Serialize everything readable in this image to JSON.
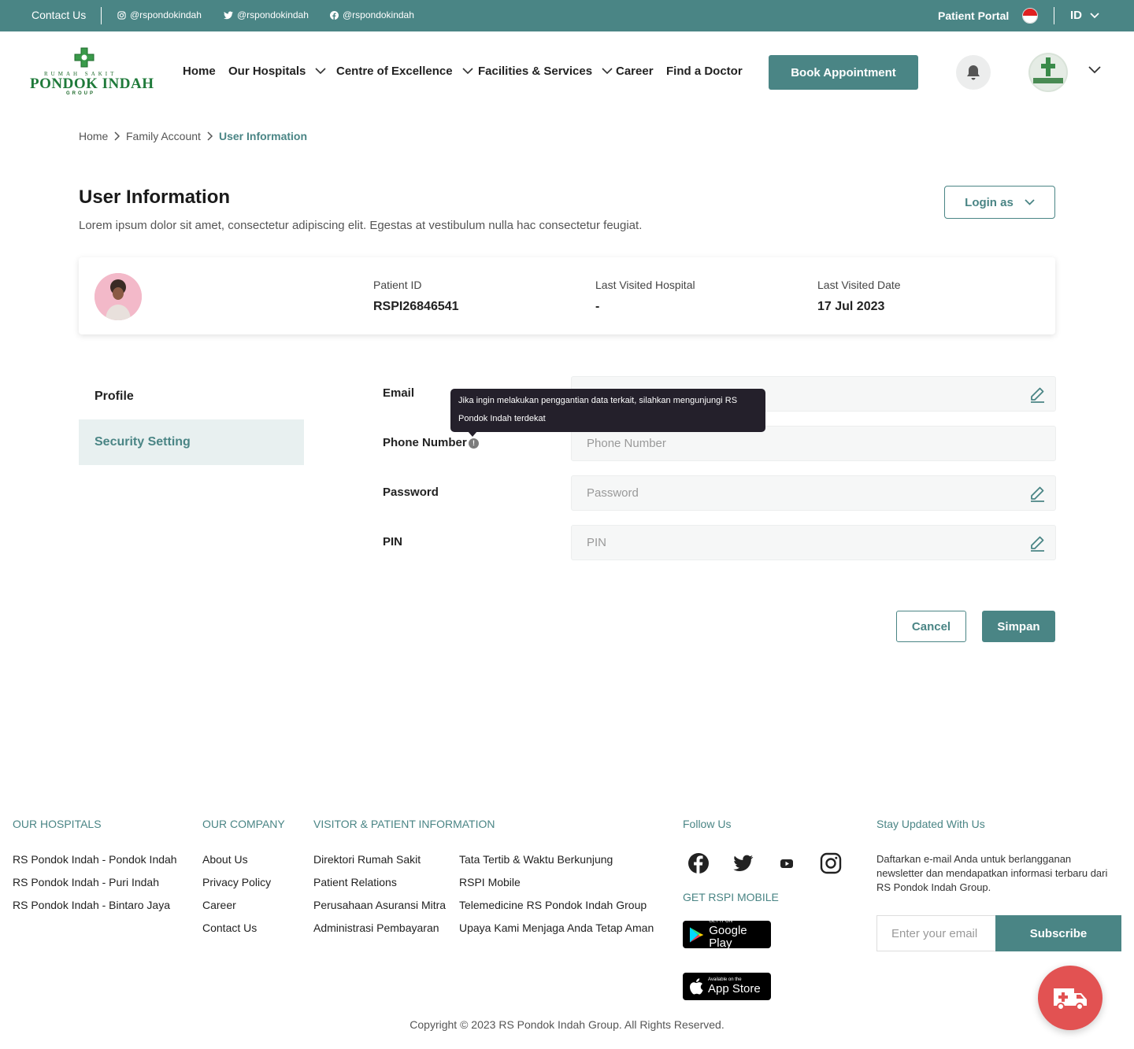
{
  "topbar": {
    "contact": "Contact Us",
    "instagram": "@rspondokindah",
    "twitter": "@rspondokindah",
    "facebook": "@rspondokindah",
    "portal": "Patient Portal",
    "lang": "ID"
  },
  "logo": {
    "top_text": "RUMAH SAKIT",
    "main_text": "PONDOK INDAH",
    "bottom_text": "GROUP"
  },
  "nav": {
    "home": "Home",
    "hospitals": "Our Hospitals",
    "excellence": "Centre of Excellence",
    "facilities": "Facilities & Services",
    "career": "Career",
    "doctor": "Find a Doctor",
    "book": "Book Appointment"
  },
  "breadcrumb": {
    "home": "Home",
    "family": "Family Account",
    "current": "User Information"
  },
  "page": {
    "title": "User Information",
    "description": "Lorem ipsum dolor sit amet, consectetur adipiscing elit. Egestas at vestibulum nulla hac consectetur feugiat.",
    "login_as": "Login as"
  },
  "patient": {
    "id_label": "Patient ID",
    "id_value": "RSPI26846541",
    "hospital_label": "Last Visited Hospital",
    "hospital_value": "-",
    "date_label": "Last Visited Date",
    "date_value": "17 Jul 2023"
  },
  "sidebar": {
    "items": [
      {
        "label": "Profile"
      },
      {
        "label": "Security Setting"
      }
    ]
  },
  "form": {
    "email_label": "Email",
    "phone_label": "Phone Number",
    "phone_placeholder": "Phone Number",
    "password_label": "Password",
    "password_placeholder": "Password",
    "pin_label": "PIN",
    "pin_placeholder": "PIN",
    "info_glyph": "!",
    "tooltip": "Jika ingin melakukan penggantian data terkait, silahkan mengunjungi RS Pondok Indah terdekat",
    "cancel": "Cancel",
    "save": "Simpan"
  },
  "footer": {
    "hospitals_head": "OUR HOSPITALS",
    "hospitals": [
      "RS Pondok Indah - Pondok Indah",
      "RS Pondok Indah - Puri Indah",
      "RS Pondok Indah - Bintaro Jaya"
    ],
    "company_head": "OUR COMPANY",
    "company": [
      "About Us",
      "Privacy Policy",
      "Career",
      "Contact Us"
    ],
    "visitor_head": "VISITOR & PATIENT INFORMATION",
    "visitor_col1": [
      "Direktori Rumah Sakit",
      "Patient Relations",
      "Perusahaan Asuransi Mitra",
      "Administrasi Pembayaran"
    ],
    "visitor_col2": [
      "Tata Tertib & Waktu Berkunjung",
      "RSPI Mobile",
      "Telemedicine RS Pondok Indah Group",
      "Upaya Kami Menjaga Anda Tetap Aman"
    ],
    "follow_head": "Follow Us",
    "mobile_head": "GET RSPI MOBILE",
    "google_small": "GET IT ON",
    "google_big": "Google Play",
    "apple_small": "Available on the",
    "apple_big": "App Store",
    "newsletter_head": "Stay Updated With Us",
    "newsletter_text": "Daftarkan e-mail Anda untuk berlangganan newsletter dan mendapatkan informasi terbaru dari RS Pondok Indah Group.",
    "email_placeholder": "Enter your email",
    "subscribe": "Subscribe",
    "copyright": "Copyright © 2023 RS Pondok Indah Group. All Rights Reserved."
  },
  "colors": {
    "primary": "#4a8585",
    "tooltip_bg": "#24202b",
    "emergency": "#e25252"
  }
}
